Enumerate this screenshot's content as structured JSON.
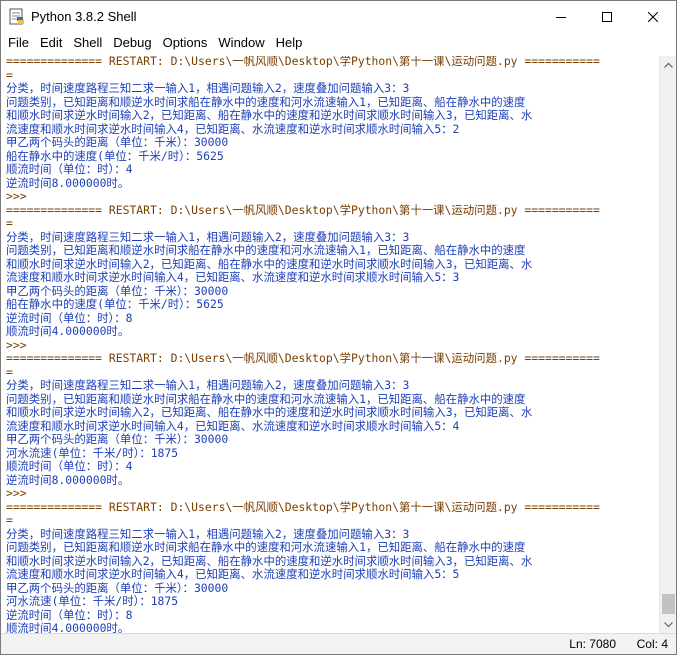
{
  "window": {
    "title": "Python 3.8.2 Shell"
  },
  "menu": [
    "File",
    "Edit",
    "Shell",
    "Debug",
    "Options",
    "Window",
    "Help"
  ],
  "colors": {
    "prompt": "#7a3e00",
    "output": "#1d3fb8",
    "input": "#000000"
  },
  "shell_lines": [
    {
      "text": "============== RESTART: D:\\Users\\一帆风顺\\Desktop\\学Python\\第十一课\\运动问题.py ===========",
      "kind": "restart"
    },
    {
      "text": "=",
      "kind": "restart"
    },
    {
      "text": "分类，时间速度路程三知二求一输入1，相遇问题输入2，速度叠加问题输入3：3",
      "kind": "out"
    },
    {
      "text": "问题类别，已知距离和顺逆水时间求船在静水中的速度和河水流速输入1，已知距离、船在静水中的速度",
      "kind": "out"
    },
    {
      "text": "和顺水时间求逆水时间输入2，已知距离、船在静水中的速度和逆水时间求顺水时间输入3，已知距离、水",
      "kind": "out"
    },
    {
      "text": "流速度和顺水时间求逆水时间输入4，已知距离、水流速度和逆水时间求顺水时间输入5：2",
      "kind": "out"
    },
    {
      "text": "甲乙两个码头的距离（单位：千米）：30000",
      "kind": "out"
    },
    {
      "text": "船在静水中的速度(单位：千米/时）：5625",
      "kind": "out"
    },
    {
      "text": "顺流时间（单位：时）：4",
      "kind": "out"
    },
    {
      "text": "逆流时间8.000000时。",
      "kind": "out"
    },
    {
      "text": ">>> ",
      "kind": "prompt"
    },
    {
      "text": "============== RESTART: D:\\Users\\一帆风顺\\Desktop\\学Python\\第十一课\\运动问题.py ===========",
      "kind": "restart"
    },
    {
      "text": "=",
      "kind": "restart"
    },
    {
      "text": "分类，时间速度路程三知二求一输入1，相遇问题输入2，速度叠加问题输入3：3",
      "kind": "out"
    },
    {
      "text": "问题类别，已知距离和顺逆水时间求船在静水中的速度和河水流速输入1，已知距离、船在静水中的速度",
      "kind": "out"
    },
    {
      "text": "和顺水时间求逆水时间输入2，已知距离、船在静水中的速度和逆水时间求顺水时间输入3，已知距离、水",
      "kind": "out"
    },
    {
      "text": "流速度和顺水时间求逆水时间输入4，已知距离、水流速度和逆水时间求顺水时间输入5：3",
      "kind": "out"
    },
    {
      "text": "甲乙两个码头的距离（单位：千米）：30000",
      "kind": "out"
    },
    {
      "text": "船在静水中的速度(单位：千米/时）：5625",
      "kind": "out"
    },
    {
      "text": "逆流时间（单位：时）：8",
      "kind": "out"
    },
    {
      "text": "顺流时间4.000000时。",
      "kind": "out"
    },
    {
      "text": ">>> ",
      "kind": "prompt"
    },
    {
      "text": "============== RESTART: D:\\Users\\一帆风顺\\Desktop\\学Python\\第十一课\\运动问题.py ===========",
      "kind": "restart"
    },
    {
      "text": "=",
      "kind": "restart"
    },
    {
      "text": "分类，时间速度路程三知二求一输入1，相遇问题输入2，速度叠加问题输入3：3",
      "kind": "out"
    },
    {
      "text": "问题类别，已知距离和顺逆水时间求船在静水中的速度和河水流速输入1，已知距离、船在静水中的速度",
      "kind": "out"
    },
    {
      "text": "和顺水时间求逆水时间输入2，已知距离、船在静水中的速度和逆水时间求顺水时间输入3，已知距离、水",
      "kind": "out"
    },
    {
      "text": "流速度和顺水时间求逆水时间输入4，已知距离、水流速度和逆水时间求顺水时间输入5：4",
      "kind": "out"
    },
    {
      "text": "甲乙两个码头的距离（单位：千米）：30000",
      "kind": "out"
    },
    {
      "text": "河水流速(单位：千米/时）：1875",
      "kind": "out"
    },
    {
      "text": "顺流时间（单位：时）：4",
      "kind": "out"
    },
    {
      "text": "逆流时间8.000000时。",
      "kind": "out"
    },
    {
      "text": ">>> ",
      "kind": "prompt"
    },
    {
      "text": "============== RESTART: D:\\Users\\一帆风顺\\Desktop\\学Python\\第十一课\\运动问题.py ===========",
      "kind": "restart"
    },
    {
      "text": "=",
      "kind": "restart"
    },
    {
      "text": "分类，时间速度路程三知二求一输入1，相遇问题输入2，速度叠加问题输入3：3",
      "kind": "out"
    },
    {
      "text": "问题类别，已知距离和顺逆水时间求船在静水中的速度和河水流速输入1，已知距离、船在静水中的速度",
      "kind": "out"
    },
    {
      "text": "和顺水时间求逆水时间输入2，已知距离、船在静水中的速度和逆水时间求顺水时间输入3，已知距离、水",
      "kind": "out"
    },
    {
      "text": "流速度和顺水时间求逆水时间输入4，已知距离、水流速度和逆水时间求顺水时间输入5：5",
      "kind": "out"
    },
    {
      "text": "甲乙两个码头的距离（单位：千米）：30000",
      "kind": "out"
    },
    {
      "text": "河水流速(单位：千米/时）：1875",
      "kind": "out"
    },
    {
      "text": "逆流时间（单位：时）：8",
      "kind": "out"
    },
    {
      "text": "顺流时间4.000000时。",
      "kind": "out"
    },
    {
      "text": ">>> ",
      "kind": "prompt",
      "cursor": true
    }
  ],
  "status": {
    "line": "Ln: 7080",
    "col": "Col: 4"
  }
}
